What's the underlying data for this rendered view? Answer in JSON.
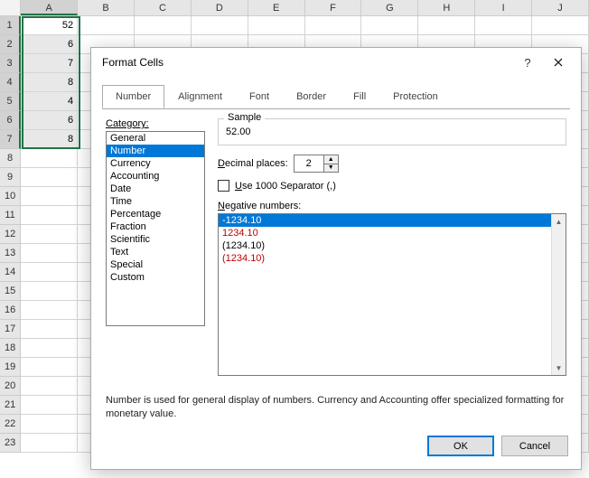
{
  "columns": [
    "A",
    "B",
    "C",
    "D",
    "E",
    "F",
    "G",
    "H",
    "I",
    "J"
  ],
  "rows": [
    1,
    2,
    3,
    4,
    5,
    6,
    7,
    8,
    9,
    10,
    11,
    12,
    13,
    14,
    15,
    16,
    17,
    18,
    19,
    20,
    21,
    22,
    23
  ],
  "cells_A": [
    "52",
    "6",
    "7",
    "8",
    "4",
    "6",
    "8"
  ],
  "selected_rows": [
    1,
    2,
    3,
    4,
    5,
    6,
    7
  ],
  "dialog": {
    "title": "Format Cells",
    "tabs": [
      "Number",
      "Alignment",
      "Font",
      "Border",
      "Fill",
      "Protection"
    ],
    "active_tab": "Number",
    "category_label": "Category:",
    "categories": [
      "General",
      "Number",
      "Currency",
      "Accounting",
      "Date",
      "Time",
      "Percentage",
      "Fraction",
      "Scientific",
      "Text",
      "Special",
      "Custom"
    ],
    "selected_category": "Number",
    "sample_label": "Sample",
    "sample_value": "52.00",
    "decimal_label": "Decimal places:",
    "decimal_value": "2",
    "thousand_label": "Use 1000 Separator (,)",
    "negative_label": "Negative numbers:",
    "negative_options": [
      {
        "text": "-1234.10",
        "red": false,
        "selected": true
      },
      {
        "text": "1234.10",
        "red": true,
        "selected": false
      },
      {
        "text": "(1234.10)",
        "red": false,
        "selected": false
      },
      {
        "text": "(1234.10)",
        "red": true,
        "selected": false
      }
    ],
    "description": "Number is used for general display of numbers.  Currency and Accounting offer specialized formatting for monetary value.",
    "ok": "OK",
    "cancel": "Cancel"
  }
}
